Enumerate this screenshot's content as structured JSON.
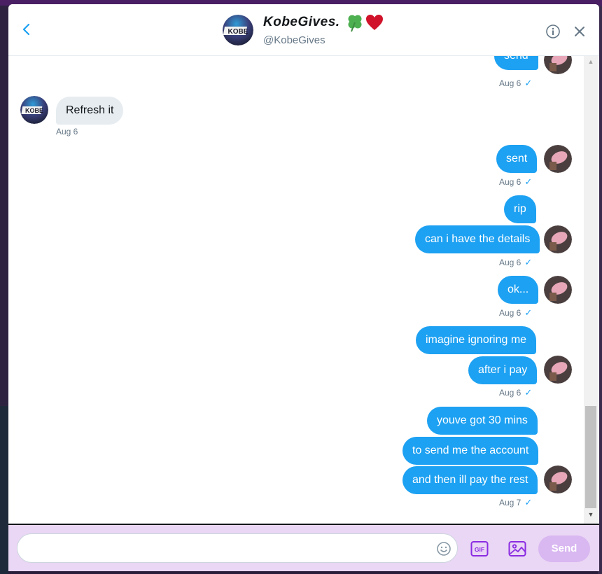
{
  "header": {
    "name": "KobeGives.",
    "handle": "@KobeGives",
    "avatar_text": "KOBE",
    "back_icon": "chevron-left-icon",
    "info_icon": "info-icon",
    "close_icon": "close-icon"
  },
  "messages": [
    {
      "text": "send",
      "direction": "out"
    },
    {
      "time": "Aug 6",
      "direction": "out"
    },
    {
      "text": "Refresh it",
      "direction": "in"
    },
    {
      "time": "Aug 6",
      "direction": "in"
    },
    {
      "text": "sent",
      "direction": "out"
    },
    {
      "time": "Aug 6",
      "direction": "out"
    },
    {
      "text": "rip",
      "direction": "out"
    },
    {
      "text": "can i have the details",
      "direction": "out"
    },
    {
      "time": "Aug 6",
      "direction": "out"
    },
    {
      "text": "ok...",
      "direction": "out"
    },
    {
      "time": "Aug 6",
      "direction": "out"
    },
    {
      "text": "imagine ignoring me",
      "direction": "out"
    },
    {
      "text": "after i pay",
      "direction": "out"
    },
    {
      "time": "Aug 6",
      "direction": "out"
    },
    {
      "text": "youve got 30 mins",
      "direction": "out"
    },
    {
      "text": "to send me the account",
      "direction": "out"
    },
    {
      "text": "and then ill pay the rest",
      "direction": "out"
    },
    {
      "time": "Aug 7",
      "direction": "out"
    }
  ],
  "composer": {
    "placeholder": "",
    "gif_label": "GIF",
    "send_label": "Send"
  },
  "colors": {
    "outgoing_bubble": "#1da1f2",
    "incoming_bubble": "#e6ecf0",
    "composer_bg": "#ead6f5",
    "send_button": "#d9b7f1",
    "icon_purple": "#8a2be2"
  }
}
